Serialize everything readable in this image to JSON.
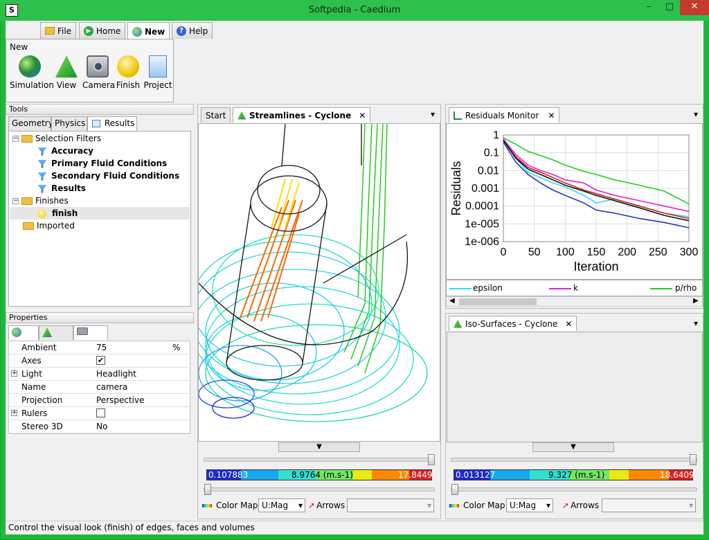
{
  "window": {
    "title": "Softpedia - Caedium",
    "app_icon": "S",
    "minimize": "–",
    "maximize": "□",
    "close": "✕"
  },
  "ribbon_tabs": [
    {
      "label": "File",
      "icon": "folder-icon"
    },
    {
      "label": "Home",
      "icon": "home-icon"
    },
    {
      "label": "New",
      "icon": "globe-icon"
    },
    {
      "label": "Help",
      "icon": "help-icon"
    }
  ],
  "ribbon": {
    "group_title": "New",
    "buttons": [
      {
        "label": "Simulation",
        "icon": "globe-icon"
      },
      {
        "label": "View",
        "icon": "view-icon"
      },
      {
        "label": "Camera",
        "icon": "camera-icon"
      },
      {
        "label": "Finish",
        "icon": "finish-icon"
      },
      {
        "label": "Project",
        "icon": "project-icon"
      }
    ]
  },
  "tools": {
    "header": "Tools",
    "tabs": [
      "Geometry",
      "Physics",
      "Results"
    ],
    "tree": [
      {
        "label": "Selection Filters",
        "level": 0,
        "kind": "folder",
        "expander": "−"
      },
      {
        "label": "Accuracy",
        "level": 1,
        "kind": "filter"
      },
      {
        "label": "Primary Fluid Conditions",
        "level": 1,
        "kind": "filter"
      },
      {
        "label": "Secondary Fluid Conditions",
        "level": 1,
        "kind": "filter"
      },
      {
        "label": "Results",
        "level": 1,
        "kind": "filter"
      },
      {
        "label": "Finishes",
        "level": 0,
        "kind": "folder",
        "expander": "−"
      },
      {
        "label": "finish",
        "level": 1,
        "kind": "finish"
      },
      {
        "label": "Imported",
        "level": 0,
        "kind": "folder",
        "expander": ""
      }
    ]
  },
  "properties": {
    "header": "Properties",
    "rows": [
      {
        "name": "Ambient",
        "value": "75",
        "unit": "%",
        "expander": ""
      },
      {
        "name": "Axes",
        "value": "✔",
        "unit": "",
        "expander": ""
      },
      {
        "name": "Light",
        "value": "Headlight",
        "unit": "",
        "expander": "+"
      },
      {
        "name": "Name",
        "value": "camera",
        "unit": "",
        "expander": ""
      },
      {
        "name": "Projection",
        "value": "Perspective",
        "unit": "",
        "expander": ""
      },
      {
        "name": "Rulers",
        "value": "",
        "unit": "",
        "expander": "+"
      },
      {
        "name": "Stereo 3D",
        "value": "No",
        "unit": "",
        "expander": ""
      }
    ]
  },
  "streamlines": {
    "tabs": [
      "Start",
      "Streamlines - Cyclone"
    ],
    "close": "✕",
    "menu": "▾",
    "cmap_min": "0.107883",
    "cmap_mid": "8.9764 (m.s-1)",
    "cmap_max": "17.8449",
    "color_map_label": "Color Map",
    "combo_value": "U:Mag",
    "arrows_label": "Arrows"
  },
  "residuals": {
    "tab": "Residuals Monitor",
    "close": "✕",
    "menu": "▾",
    "legend": [
      "epsilon",
      "k",
      "p/rho"
    ]
  },
  "isosurfaces": {
    "tab": "Iso-Surfaces - Cyclone",
    "close": "✕",
    "menu": "▾",
    "cmap_min": "0.013127",
    "cmap_mid": "9.327 (m.s-1)",
    "cmap_max": "18.6409",
    "color_map_label": "Color Map",
    "combo_value": "U:Mag",
    "arrows_label": "Arrows"
  },
  "chart_data": {
    "type": "line",
    "xlabel": "Iteration",
    "ylabel": "Residuals",
    "xlim": [
      0,
      300
    ],
    "ylim_log": [
      1e-06,
      1
    ],
    "x_ticks": [
      "0",
      "50",
      "100",
      "150",
      "200",
      "250",
      "300"
    ],
    "y_ticks": [
      "1",
      "0.1",
      "0.01",
      "0.001",
      "0.0001",
      "1e-005",
      "1e-006"
    ],
    "series": [
      {
        "name": "epsilon",
        "color": "#33ddee",
        "x": [
          0,
          20,
          40,
          60,
          80,
          100,
          130,
          150,
          180,
          220,
          260,
          300
        ],
        "y": [
          0.6,
          0.05,
          0.008,
          0.004,
          0.002,
          0.0012,
          0.0004,
          0.00015,
          0.00025,
          0.0001,
          4e-05,
          2.5e-05
        ]
      },
      {
        "name": "k",
        "color": "#dd22cc",
        "x": [
          0,
          20,
          40,
          60,
          80,
          100,
          130,
          150,
          180,
          220,
          260,
          300
        ],
        "y": [
          0.6,
          0.08,
          0.02,
          0.01,
          0.006,
          0.003,
          0.002,
          0.0008,
          0.0004,
          0.0002,
          0.0001,
          5e-05
        ]
      },
      {
        "name": "p/rho",
        "color": "#22cc22",
        "x": [
          0,
          20,
          40,
          60,
          80,
          100,
          130,
          150,
          180,
          220,
          260,
          300
        ],
        "y": [
          0.7,
          0.3,
          0.12,
          0.07,
          0.04,
          0.02,
          0.009,
          0.006,
          0.003,
          0.0015,
          0.0007,
          0.00013
        ]
      },
      {
        "name": "",
        "color": "#cc2222",
        "x": [
          0,
          20,
          40,
          60,
          80,
          100,
          130,
          150,
          180,
          220,
          260,
          300
        ],
        "y": [
          0.5,
          0.06,
          0.015,
          0.008,
          0.004,
          0.002,
          0.0008,
          0.0005,
          0.00025,
          0.0001,
          4e-05,
          2e-05
        ]
      },
      {
        "name": "",
        "color": "#111111",
        "x": [
          0,
          20,
          40,
          60,
          80,
          100,
          130,
          150,
          180,
          220,
          260,
          300
        ],
        "y": [
          0.5,
          0.05,
          0.012,
          0.006,
          0.003,
          0.0015,
          0.0007,
          0.0004,
          0.0002,
          8e-05,
          3e-05,
          1.5e-05
        ]
      },
      {
        "name": "",
        "color": "#2233cc",
        "x": [
          0,
          20,
          40,
          60,
          80,
          100,
          130,
          150,
          180,
          220,
          260,
          300
        ],
        "y": [
          0.4,
          0.03,
          0.006,
          0.002,
          0.0008,
          0.0004,
          0.00015,
          6e-05,
          4e-05,
          2e-05,
          1.2e-05,
          6e-06
        ]
      }
    ],
    "grid": true,
    "legend_position": "bottom"
  },
  "status": {
    "text": "Control the visual look (finish) of edges, faces and volumes"
  }
}
